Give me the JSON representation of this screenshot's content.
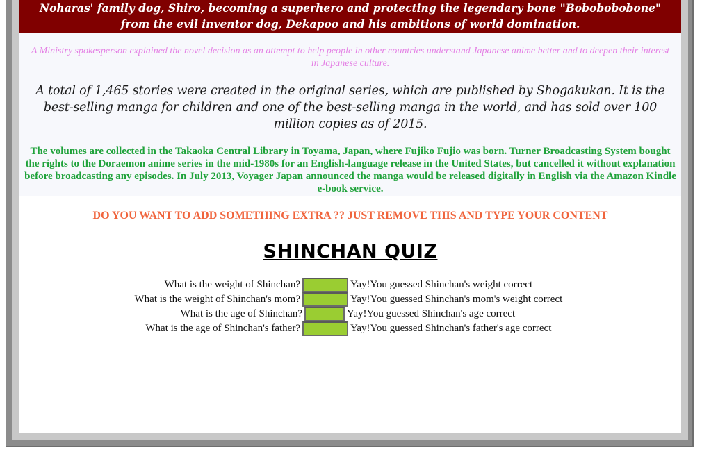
{
  "banner": {
    "text": "Noharas' family dog, Shiro, becoming a superhero and protecting the legendary bone \"Bobobobobone\" from the evil inventor dog, Dekapoo and his ambitions of world domination."
  },
  "paragraphs": {
    "pink": "A Ministry spokesperson explained the novel decision as an attempt to help people in other countries understand Japanese anime better and to deepen their interest in Japanese culture.",
    "script": "A total of 1,465 stories were created in the original series, which are published by Shogakukan. It is the best-selling manga for children and one of the best-selling manga in the world, and has sold over 100 million copies as of 2015.",
    "green": "The volumes are collected in the Takaoka Central Library in Toyama, Japan, where Fujiko Fujio was born. Turner Broadcasting System bought the rights to the Doraemon anime series in the mid-1980s for an English-language release in the United States, but cancelled it without explanation before broadcasting any episodes. In July 2013, Voyager Japan announced the manga would be released digitally in English via the Amazon Kindle e-book service."
  },
  "extra": "DO YOU WANT TO ADD SOMETHING EXTRA ?? JUST REMOVE THIS AND TYPE YOUR CONTENT",
  "quiz": {
    "title": "SHINCHAN QUIZ",
    "questions": [
      {
        "label": "What is the weight of Shinchan?",
        "value": "",
        "result": "Yay!You guessed Shinchan's weight correct"
      },
      {
        "label": "What is the weight of Shinchan's mom?",
        "value": "",
        "result": "Yay!You guessed Shinchan's mom's weight correct"
      },
      {
        "label": "What is the age of Shinchan?",
        "value": "",
        "result": "Yay!You guessed Shinchan's age correct"
      },
      {
        "label": "What is the age of Shinchan's father?",
        "value": "",
        "result": "Yay!You guessed Shinchan's father's age correct"
      }
    ],
    "input_color": "#9acd32"
  },
  "colors": {
    "banner_bg": "#800000",
    "pink_text": "#e47fe4",
    "green_text": "#1fa23a",
    "extra_text": "#f0643c"
  }
}
